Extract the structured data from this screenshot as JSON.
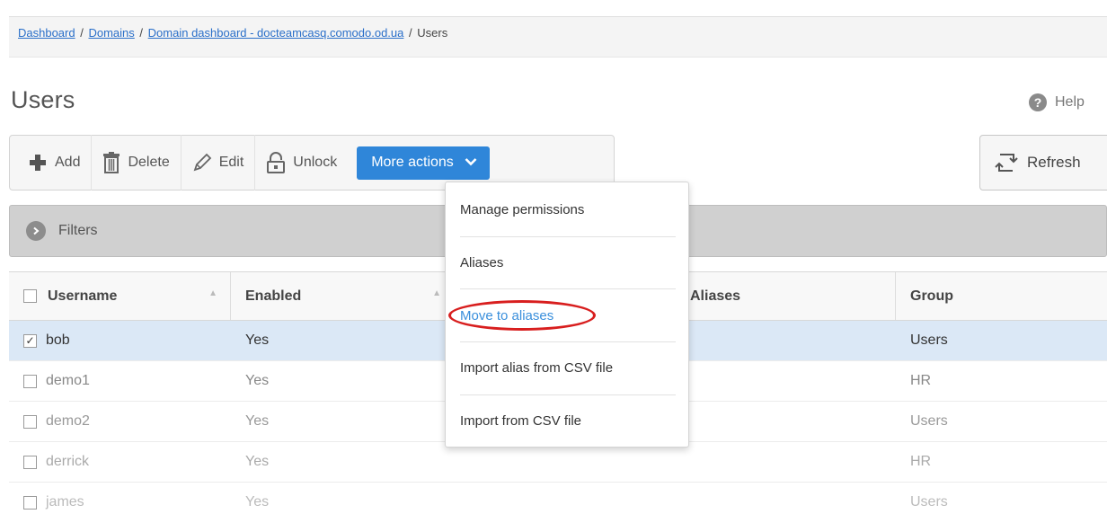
{
  "breadcrumb": {
    "items": [
      "Dashboard",
      "Domains",
      "Domain dashboard - docteamcasq.comodo.od.ua"
    ],
    "current": "Users",
    "separator": "/"
  },
  "page": {
    "title": "Users"
  },
  "help": {
    "label": "Help",
    "icon": "?"
  },
  "toolbar": {
    "add": "Add",
    "delete": "Delete",
    "edit": "Edit",
    "unlock": "Unlock",
    "more_actions": "More actions"
  },
  "refresh": {
    "label": "Refresh"
  },
  "filters": {
    "label": "Filters"
  },
  "table": {
    "columns": [
      "Username",
      "Enabled",
      "",
      "Aliases",
      "Group"
    ],
    "rows": [
      {
        "username": "bob",
        "enabled": "Yes",
        "group": "Users",
        "checked": true
      },
      {
        "username": "demo1",
        "enabled": "Yes",
        "group": "HR",
        "checked": false
      },
      {
        "username": "demo2",
        "enabled": "Yes",
        "group": "Users",
        "checked": false
      },
      {
        "username": "derrick",
        "enabled": "Yes",
        "group": "HR",
        "checked": false
      },
      {
        "username": "james",
        "enabled": "Yes",
        "group": "Users",
        "checked": false
      }
    ]
  },
  "dropdown": {
    "items": [
      "Manage permissions",
      "Aliases",
      "Move to aliases",
      "Import alias from CSV file",
      "Import from CSV file"
    ],
    "highlighted": "Move to aliases"
  },
  "colors": {
    "accent": "#2f86d9",
    "link": "#2a6fc9",
    "highlight_oval": "#d81e1e",
    "selected_row": "#dbe8f6"
  }
}
